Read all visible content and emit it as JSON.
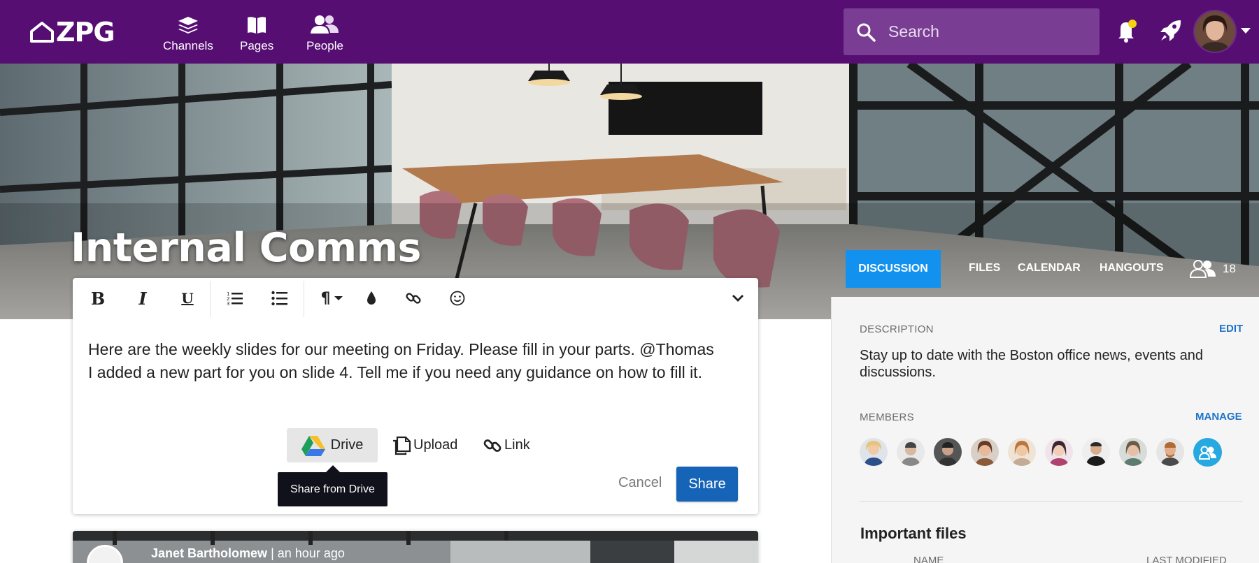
{
  "brand": {
    "logo_text": "ZPG",
    "primary_color": "#560e73",
    "accent_color": "#1292ee"
  },
  "nav": {
    "items": [
      {
        "label": "Channels",
        "icon": "layers-icon"
      },
      {
        "label": "Pages",
        "icon": "book-icon"
      },
      {
        "label": "People",
        "icon": "people-icon"
      }
    ]
  },
  "search": {
    "placeholder": "Search"
  },
  "header_icons": {
    "notifications": "bell-icon",
    "launcher": "rocket-icon",
    "notification_dot_color": "#f5d311"
  },
  "channel": {
    "title": "Internal Comms"
  },
  "tabs": {
    "items": [
      {
        "label": "DISCUSSION",
        "active": true
      },
      {
        "label": "FILES"
      },
      {
        "label": "CALENDAR"
      },
      {
        "label": "HANGOUTS"
      }
    ],
    "member_count": "18"
  },
  "composer": {
    "toolbar": [
      "bold-icon",
      "italic-icon",
      "underline-icon",
      "numbered-list-icon",
      "bullet-list-icon",
      "paragraph-icon",
      "color-drop-icon",
      "link-icon",
      "emoji-icon",
      "collapse-chevron-icon"
    ],
    "text": "Here are the weekly slides for our meeting on Friday. Please fill in your parts. @Thomas I added a new part for you on slide 4. Tell me if you need any guidance on how to fill it.",
    "attach": {
      "drive": "Drive",
      "upload": "Upload",
      "link": "Link"
    },
    "tooltip": "Share from Drive",
    "cancel": "Cancel",
    "share": "Share"
  },
  "sidebar": {
    "description_label": "DESCRIPTION",
    "edit": "EDIT",
    "description": "Stay up to date with the Boston office news, events and discussions.",
    "members_label": "MEMBERS",
    "manage": "MANAGE",
    "important_files": "Important files",
    "columns": {
      "name": "NAME",
      "last_modified": "LAST MODIFIED"
    }
  },
  "post": {
    "author": "Janet Bartholomew",
    "separator": "|",
    "time": "an hour ago"
  }
}
